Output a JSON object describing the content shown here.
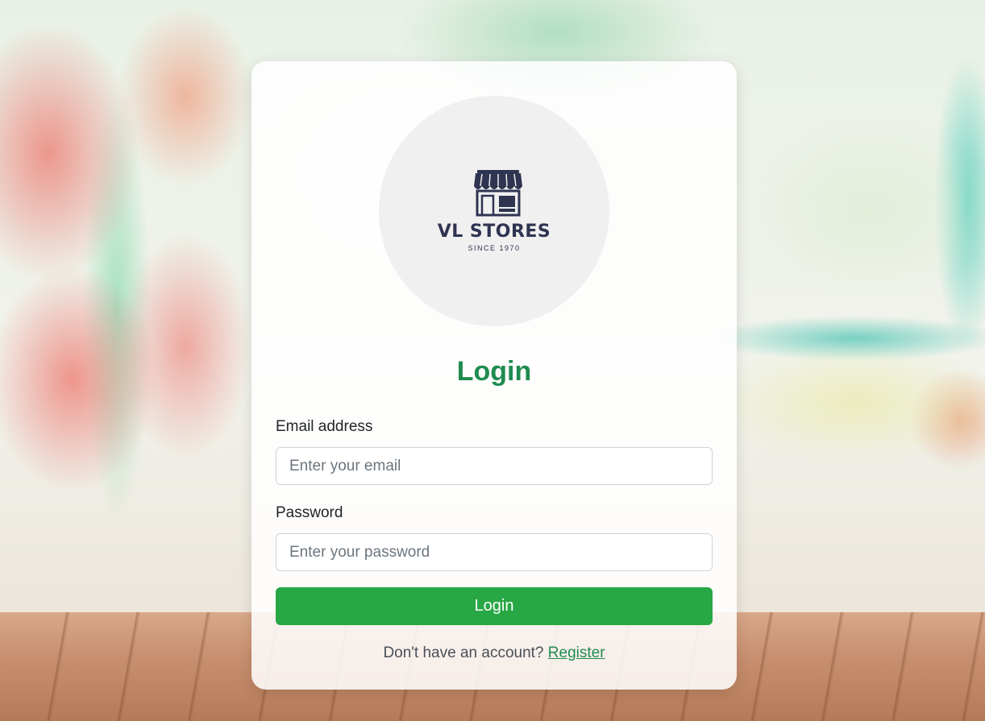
{
  "brand": {
    "name": "VL STORES",
    "tagline": "SINCE 1970",
    "logo_icon": "storefront-icon",
    "logo_color": "#2f3451"
  },
  "form": {
    "title": "Login",
    "email_label": "Email address",
    "email_placeholder": "Enter your email",
    "email_value": "",
    "password_label": "Password",
    "password_placeholder": "Enter your password",
    "password_value": "",
    "submit_label": "Login"
  },
  "footer": {
    "prompt": "Don't have an account?",
    "register_link": "Register"
  },
  "colors": {
    "accent_green": "#1f8b4f",
    "button_green": "#28a745"
  }
}
